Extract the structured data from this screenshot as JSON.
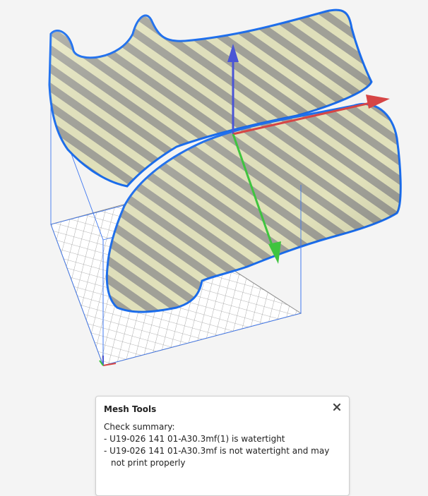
{
  "colors": {
    "background": "#f4f4f4",
    "model_light": "#eeeec6",
    "model_dark": "#a9a9a0",
    "selection_outline": "#1c6ff0",
    "bounding_box": "#3f78f0",
    "axis_x": "#d64545",
    "axis_y": "#3fc43f",
    "axis_z": "#4a55d6",
    "build_plate_line": "#9a9a9a"
  },
  "viewport": {
    "gizmo": {
      "x_axis_icon": "arrow-red",
      "y_axis_icon": "arrow-green",
      "z_axis_icon": "arrow-blue"
    }
  },
  "mesh_tools": {
    "title": "Mesh Tools",
    "close_icon": "close-icon",
    "summary_heading": "Check summary:",
    "lines": [
      " - U19-026 141 01-A30.3mf(1) is watertight",
      " - U19-026 141 01-A30.3mf is not watertight and may not print properly"
    ]
  }
}
